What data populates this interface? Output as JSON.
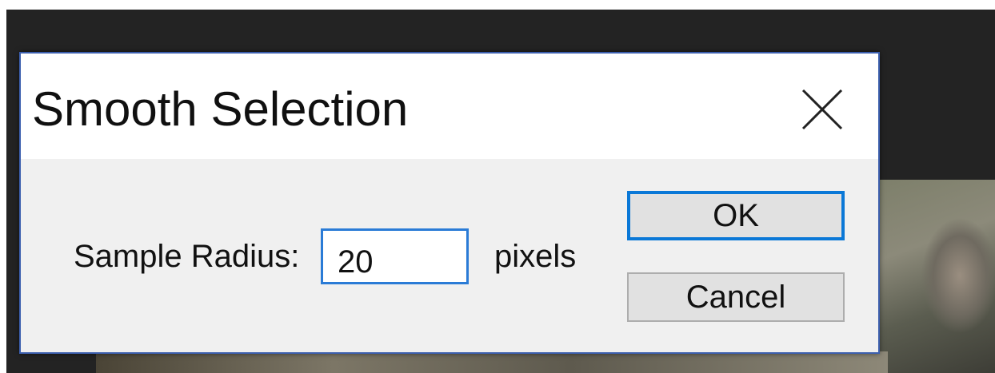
{
  "dialog": {
    "title": "Smooth Selection",
    "close_icon": "close-icon"
  },
  "form": {
    "radius_label": "Sample Radius:",
    "radius_value": "20",
    "unit_label": "pixels"
  },
  "buttons": {
    "ok_label": "OK",
    "cancel_label": "Cancel"
  },
  "colors": {
    "accent": "#0a78d7",
    "dialog_border": "#3c5fae",
    "app_background": "#232323"
  }
}
